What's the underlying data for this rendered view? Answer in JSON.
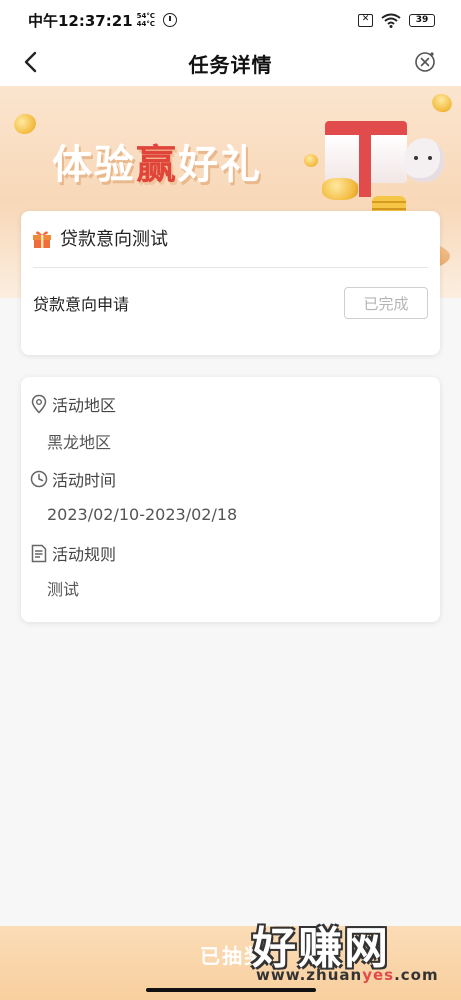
{
  "status_bar": {
    "time": "中午12:37:21",
    "temp_top": "54°C",
    "temp_bottom": "44°C",
    "sim": "✕",
    "battery": "39"
  },
  "nav": {
    "title": "任务详情"
  },
  "banner": {
    "title_part1": "体验",
    "title_highlight": "赢",
    "title_part2": "好礼"
  },
  "task": {
    "title": "贷款意向测试",
    "name": "贷款意向申请",
    "status": "已完成"
  },
  "info": {
    "region_label": "活动地区",
    "region_value": "黑龙地区",
    "time_label": "活动时间",
    "time_value": "2023/02/10-2023/02/18",
    "rules_label": "活动规则",
    "rules_value": "测试"
  },
  "bottom": {
    "button_text": "已抽奖"
  },
  "watermark": {
    "text": "好赚网",
    "url_prefix": "www.zhuan",
    "url_highlight": "yes",
    "url_suffix": ".com"
  }
}
